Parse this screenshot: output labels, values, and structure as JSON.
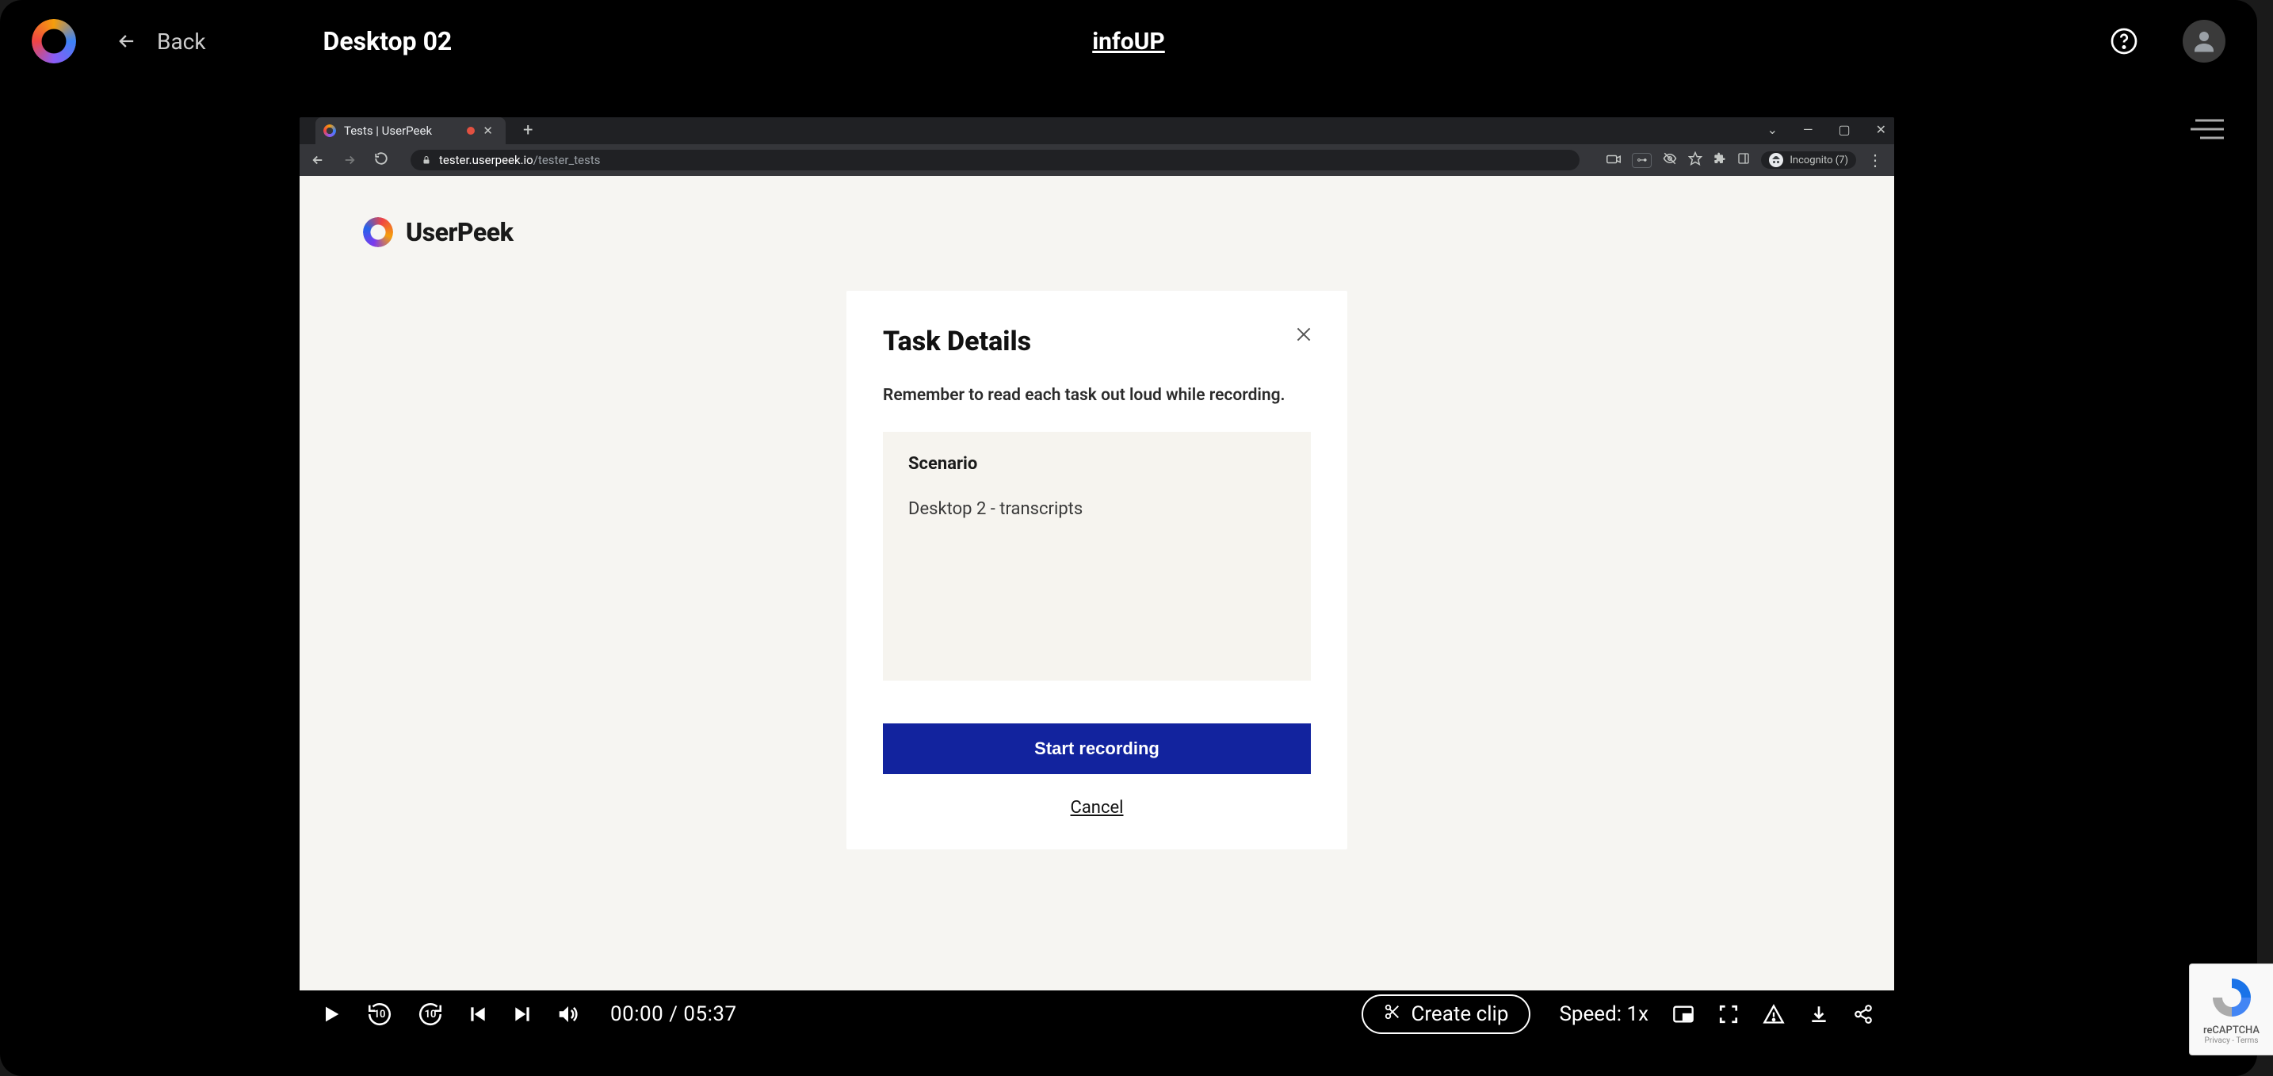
{
  "header": {
    "back_label": "Back",
    "title": "Desktop 02",
    "center_link": "infoUP"
  },
  "browser": {
    "tab_title": "Tests | UserPeek",
    "url_host": "tester.userpeek.io",
    "url_path": "/tester_tests",
    "incognito_label": "Incognito (7)"
  },
  "page": {
    "brand": "UserPeek",
    "modal": {
      "title": "Task Details",
      "subtitle": "Remember to read each task out loud while recording.",
      "scenario_label": "Scenario",
      "scenario_text": "Desktop 2 - transcripts",
      "start_label": "Start recording",
      "cancel_label": "Cancel"
    }
  },
  "player": {
    "current_time": "00:00",
    "separator": "/",
    "duration": "05:37",
    "rewind_amount": "10",
    "forward_amount": "10",
    "clip_label": "Create clip",
    "speed_label": "Speed: 1x"
  },
  "recaptcha": {
    "title": "reCAPTCHA",
    "sub": "Privacy - Terms"
  }
}
